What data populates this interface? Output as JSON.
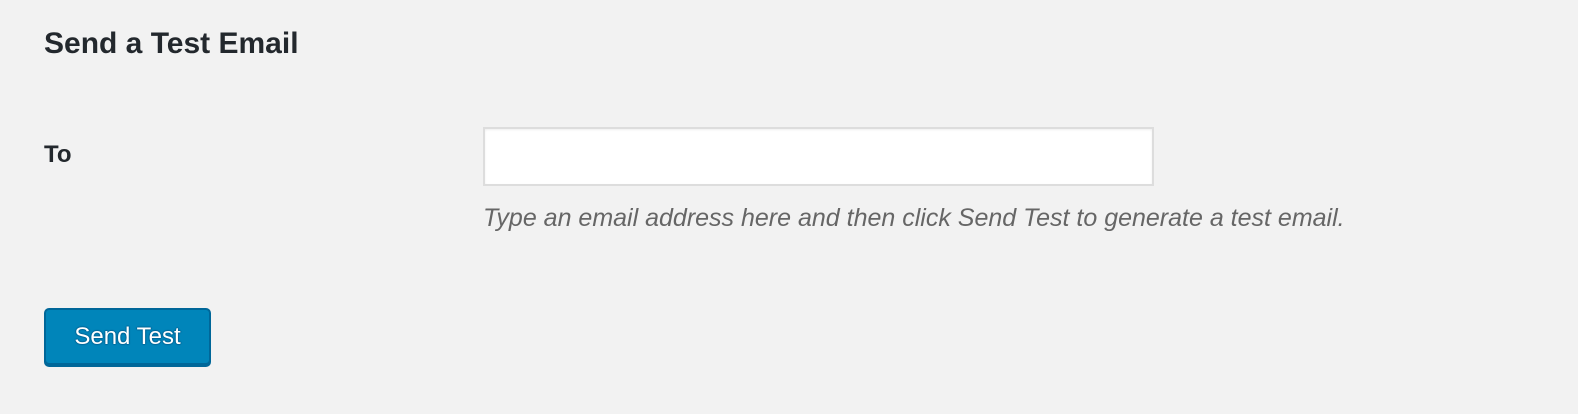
{
  "section": {
    "title": "Send a Test Email"
  },
  "to_field": {
    "label": "To",
    "value": "",
    "placeholder": "",
    "description": "Type an email address here and then click Send Test to generate a test email."
  },
  "actions": {
    "send_label": "Send Test"
  },
  "colors": {
    "background": "#f2f2f2",
    "button": "#0085ba",
    "button_border": "#006799",
    "heading_text": "#23282d",
    "description_text": "#666666"
  }
}
